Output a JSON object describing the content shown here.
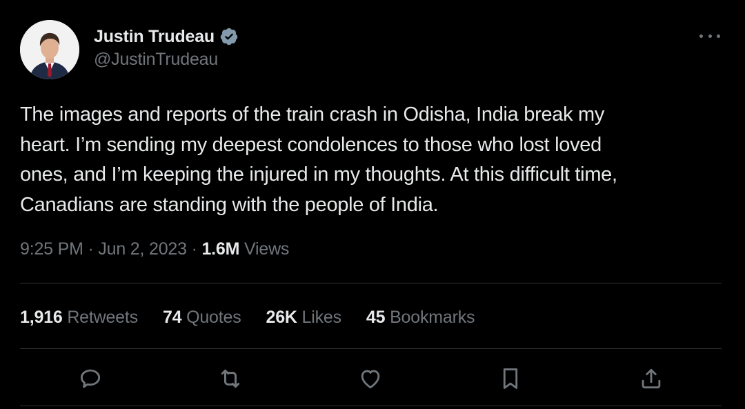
{
  "author": {
    "display_name": "Justin Trudeau",
    "handle": "@JustinTrudeau",
    "verified": true
  },
  "tweet": {
    "text_lines": [
      "The images and reports of the train crash in Odisha, India break my",
      "heart. I’m sending my deepest condolences to those who lost loved",
      "ones, and I’m keeping the injured in my thoughts. At this difficult time,",
      "Canadians are standing with the people of India."
    ],
    "time": "9:25 PM",
    "separator": "·",
    "date": "Jun 2, 2023",
    "views_count": "1.6M",
    "views_label": "Views"
  },
  "stats": [
    {
      "count": "1,916",
      "label": "Retweets"
    },
    {
      "count": "74",
      "label": "Quotes"
    },
    {
      "count": "26K",
      "label": "Likes"
    },
    {
      "count": "45",
      "label": "Bookmarks"
    }
  ],
  "actions": [
    {
      "icon": "reply-icon"
    },
    {
      "icon": "retweet-icon"
    },
    {
      "icon": "like-icon"
    },
    {
      "icon": "bookmark-icon"
    },
    {
      "icon": "share-icon"
    }
  ],
  "colors": {
    "background": "#000000",
    "primary_text": "#e7e9ea",
    "secondary_text": "#71767b",
    "divider": "#2f3336",
    "verified_badge": "#829aab"
  }
}
